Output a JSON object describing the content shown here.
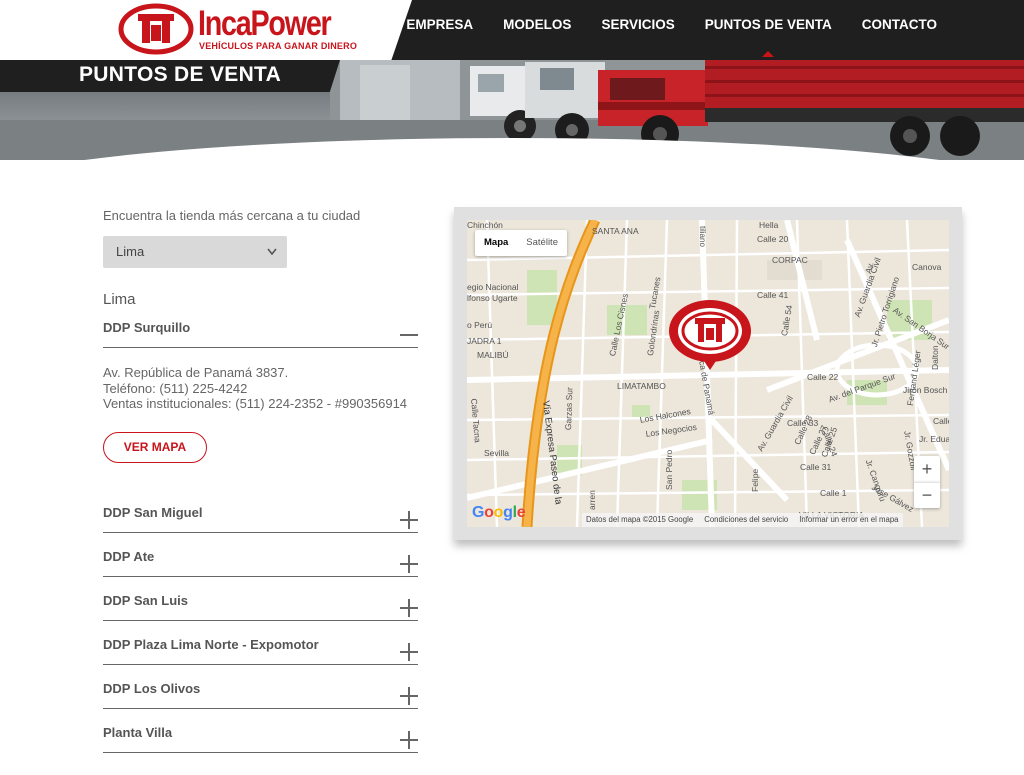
{
  "brand": {
    "name": "IncaPower",
    "tagline": "VEHÍCULOS PARA GANAR DINERO",
    "color": "#c8141b"
  },
  "nav": {
    "items": [
      "EMPRESA",
      "MODELOS",
      "SERVICIOS",
      "PUNTOS DE VENTA",
      "CONTACTO"
    ],
    "active": "PUNTOS DE VENTA"
  },
  "hero": {
    "title": "PUNTOS DE VENTA"
  },
  "locator": {
    "intro": "Encuentra la tienda más cercana a tu ciudad",
    "city_select": {
      "value": "Lima"
    },
    "city_heading": "Lima",
    "stores": [
      {
        "name": "DDP Surquillo",
        "expanded": true
      },
      {
        "name": "DDP San Miguel",
        "expanded": false
      },
      {
        "name": "DDP Ate",
        "expanded": false
      },
      {
        "name": "DDP San Luis",
        "expanded": false
      },
      {
        "name": "DDP Plaza Lima Norte - Expomotor",
        "expanded": false
      },
      {
        "name": "DDP Los Olivos",
        "expanded": false
      },
      {
        "name": "Planta Villa",
        "expanded": false
      }
    ],
    "detail": {
      "address": "Av. República de Panamá 3837.",
      "phone": "Teléfono: (511) 225-4242",
      "sales": "Ventas institucionales: (511) 224-2352 - #990356914",
      "map_button": "VER MAPA"
    }
  },
  "map": {
    "type_control": {
      "map": "Mapa",
      "satellite": "Satélite",
      "selected": "Mapa"
    },
    "zoom_in": "+",
    "zoom_out": "−",
    "attribution": {
      "data": "Datos del mapa ©2015 Google",
      "terms": "Condiciones del servicio",
      "report": "Informar un error en el mapa"
    },
    "labels": {
      "chinchon": "Chinchón",
      "santa_ana": "SANTA ANA",
      "calle20": "Calle 20",
      "corpac": "CORPAC",
      "canova": "Canova",
      "colegio": "egio Nacional",
      "alfonso": "lfonso Ugarte",
      "peru": "o Perú",
      "jadra": "JADRA 1",
      "malibu": "MALIBÚ",
      "cisnes": "Calle Los Cisnes",
      "tucanes": "Tucanes",
      "golondrinas": "Golondrinas",
      "calle41": "Calle 41",
      "calle54": "Calle 54",
      "guardia_civil": "Av. Guardia Civil",
      "torrigiano": "Jr. Pietro Torrigiano",
      "san_borja": "Av. San Borja Sur",
      "dalton": "Dalton",
      "limatambo": "LIMATAMBO",
      "garzas": "Garzas Sur",
      "calle22": "Calle 22",
      "parque_sur": "Av. del Parque Sur",
      "fernand": "Fernand Léger",
      "bosch": "Jirón Bosch",
      "gozzoli": "Jr. Gozzoli",
      "edua": "Jr. Edua",
      "calle": "Calle",
      "halcones": "Los Halcones",
      "negocios": "Los Negocios",
      "panama": "ca de Panamá",
      "tacna": "Calle Tacna",
      "sevilla": "Sevilla",
      "expresa": "Vía Expresa Paseo de la",
      "calle33": "Calle 33",
      "calle28": "Calle 28",
      "calle27": "Calle 27",
      "calle24": "Calle 24",
      "calle25": "Calle 25",
      "calle31": "Calle 31",
      "calle1": "Calle 1",
      "guardia_civil2": "Av. Guardia Civil",
      "felipe": "Felipe",
      "san_pedro": "San Pedro",
      "arren": "arren",
      "villa_victoria": "VILLA VICTORIA",
      "jose_galvez": "Jose Gálvez",
      "hella": "Hella",
      "canguru": "Jr. Canguru",
      "tiliano": "tiliano",
      "av_aviacion": "Av."
    },
    "colors": {
      "road": "#ffffff",
      "highway": "#f5a623",
      "park": "#cfe4b4",
      "land": "#ece6db"
    }
  }
}
